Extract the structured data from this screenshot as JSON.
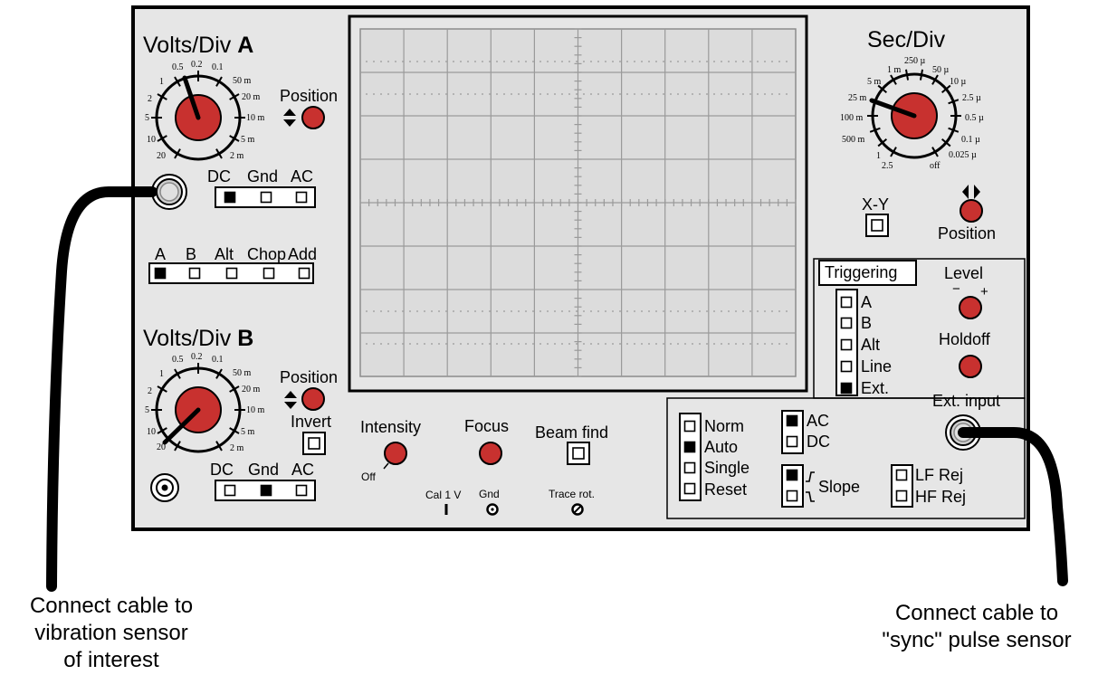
{
  "channel_a": {
    "title": "Volts/Div",
    "letter": "A",
    "dial_labels": [
      "0.5",
      "0.2",
      "0.1",
      "1",
      "50 m",
      "2",
      "20 m",
      "5",
      "10 m",
      "10",
      "5 m",
      "20",
      "2 m"
    ],
    "position_label": "Position",
    "coupling": [
      {
        "label": "DC",
        "active": true
      },
      {
        "label": "Gnd",
        "active": false
      },
      {
        "label": "AC",
        "active": false
      }
    ]
  },
  "vertical_mode": {
    "options": [
      {
        "label": "A",
        "active": true
      },
      {
        "label": "B",
        "active": false
      },
      {
        "label": "Alt",
        "active": false
      },
      {
        "label": "Chop",
        "active": false
      },
      {
        "label": "Add",
        "active": false
      }
    ]
  },
  "channel_b": {
    "title": "Volts/Div",
    "letter": "B",
    "dial_labels": [
      "0.5",
      "0.2",
      "0.1",
      "1",
      "50 m",
      "2",
      "20 m",
      "5",
      "10 m",
      "10",
      "5 m",
      "20",
      "2 m"
    ],
    "position_label": "Position",
    "invert_label": "Invert",
    "coupling": [
      {
        "label": "DC",
        "active": false
      },
      {
        "label": "Gnd",
        "active": true
      },
      {
        "label": "AC",
        "active": false
      }
    ]
  },
  "display_controls": {
    "intensity": "Intensity",
    "off": "Off",
    "focus": "Focus",
    "beam_find": "Beam find",
    "cal": "Cal  1  V",
    "gnd": "Gnd",
    "trace_rot": "Trace rot."
  },
  "timebase": {
    "title": "Sec/Div",
    "dial_labels": [
      "250 µ",
      "1 m",
      "50 µ",
      "5 m",
      "10 µ",
      "25 m",
      "2.5 µ",
      "100 m",
      "0.5 µ",
      "500 m",
      "0.1 µ",
      "1",
      "0.025 µ",
      "2.5",
      "off"
    ],
    "xy_label": "X-Y",
    "position_label": "Position"
  },
  "triggering": {
    "title": "Triggering",
    "sources": [
      {
        "label": "A",
        "active": false
      },
      {
        "label": "B",
        "active": false
      },
      {
        "label": "Alt",
        "active": false
      },
      {
        "label": "Line",
        "active": false
      },
      {
        "label": "Ext.",
        "active": true
      }
    ],
    "level_label": "Level",
    "minus": "−",
    "plus": "+",
    "holdoff_label": "Holdoff",
    "ext_input_label": "Ext. input",
    "modes": [
      {
        "label": "Norm",
        "active": false
      },
      {
        "label": "Auto",
        "active": true
      },
      {
        "label": "Single",
        "active": false
      },
      {
        "label": "Reset",
        "active": false
      }
    ],
    "coupling": [
      {
        "label": "AC",
        "active": true
      },
      {
        "label": "DC",
        "active": false
      }
    ],
    "slope_label": "Slope",
    "slope": [
      {
        "active": true
      },
      {
        "active": false
      }
    ],
    "filters": [
      {
        "label": "LF Rej",
        "active": false
      },
      {
        "label": "HF Rej",
        "active": false
      }
    ]
  },
  "annotations": {
    "left": [
      "Connect cable to",
      "vibration sensor",
      "of interest"
    ],
    "right": [
      "Connect cable to",
      "\"sync\" pulse sensor"
    ]
  },
  "colors": {
    "panel": "#e6e6e6",
    "screen": "#dcdcdc",
    "knob": "#c8312f",
    "grid": "#9a9a9a",
    "outline": "#000000"
  }
}
